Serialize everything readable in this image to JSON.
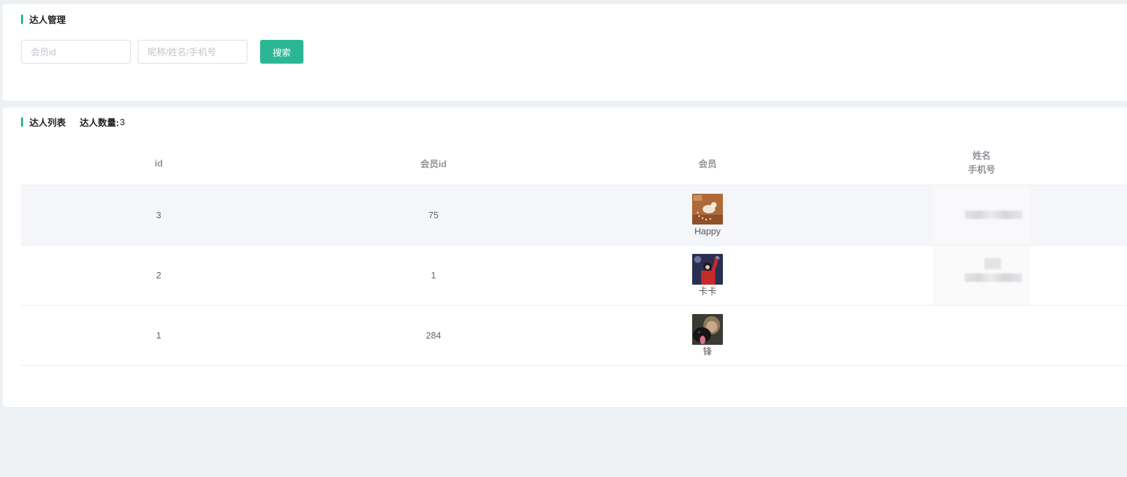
{
  "search_section": {
    "title": "达人管理",
    "member_id_placeholder": "会员id",
    "keyword_placeholder": "昵称/姓名/手机号",
    "search_label": "搜索"
  },
  "list_section": {
    "title": "达人列表",
    "count_label": "达人数量:",
    "count_value": "3"
  },
  "table": {
    "headers": {
      "id": "id",
      "member_id": "会员id",
      "member": "会员",
      "name": "姓名",
      "phone": "手机号"
    },
    "rows": [
      {
        "id": "3",
        "member_id": "75",
        "member_name": "Happy"
      },
      {
        "id": "2",
        "member_id": "1",
        "member_name": "卡卡"
      },
      {
        "id": "1",
        "member_id": "284",
        "member_name": "锋"
      }
    ]
  },
  "colors": {
    "accent": "#2bb794",
    "page_bg": "#eef1f4",
    "stripe_bg": "#f4f6f9"
  }
}
